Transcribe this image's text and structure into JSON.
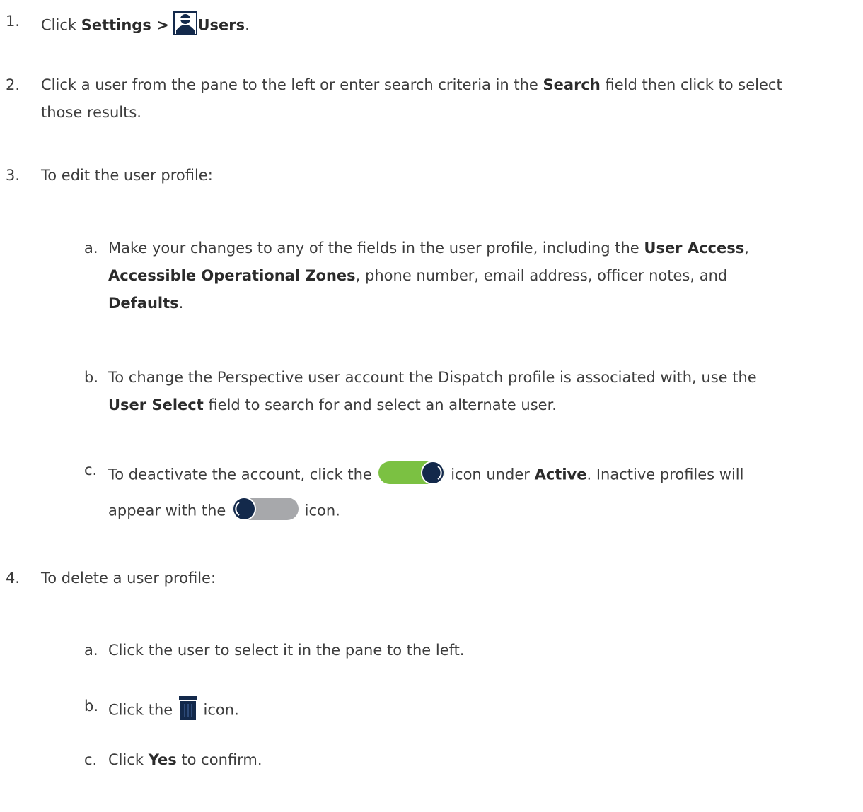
{
  "steps": [
    {
      "num": "1.",
      "t1": "Click ",
      "b1": "Settings >",
      "b2": "Users",
      "t2": "."
    },
    {
      "num": "2.",
      "l1a": "Click a user from the pane to the left or enter search criteria in the ",
      "l1b": "Search",
      "l1c": " field then click to select",
      "l2": "those results."
    },
    {
      "num": "3.",
      "text": "To edit the user profile:",
      "a": {
        "num": "a.",
        "l1a": "Make your changes to any of the fields in the user profile, including the ",
        "l1b": "User Access",
        "l1c": ",",
        "l2a": "Accessible Operational Zones",
        "l2b": ", phone number, email address, officer notes, and",
        "l3a": "Defaults",
        "l3b": "."
      },
      "b": {
        "num": "b.",
        "l1": "To change the Perspective user account the Dispatch profile is associated with, use the",
        "l2a": "User Select",
        "l2b": " field to search for and select an alternate user."
      },
      "c": {
        "num": "c.",
        "l1a": "To deactivate the account, click the ",
        "l1b": " icon under ",
        "l1c": "Active",
        "l1d": ". Inactive profiles will",
        "l2a": "appear with the ",
        "l2b": " icon."
      }
    },
    {
      "num": "4.",
      "text": "To delete a user profile:",
      "a": {
        "num": "a.",
        "text": "Click the user to select it in the pane to the left."
      },
      "b": {
        "num": "b.",
        "t1": "Click the ",
        "t2": " icon."
      },
      "c": {
        "num": "c.",
        "t1": "Click ",
        "b1": "Yes",
        "t2": " to confirm."
      }
    }
  ],
  "colors": {
    "toggle_on": "#7bc142",
    "toggle_off": "#a7a8ab",
    "knob": "#13294b",
    "icon_navy": "#13294b"
  },
  "icons": [
    "user-icon",
    "toggle-on-icon",
    "toggle-off-icon",
    "trash-icon"
  ]
}
